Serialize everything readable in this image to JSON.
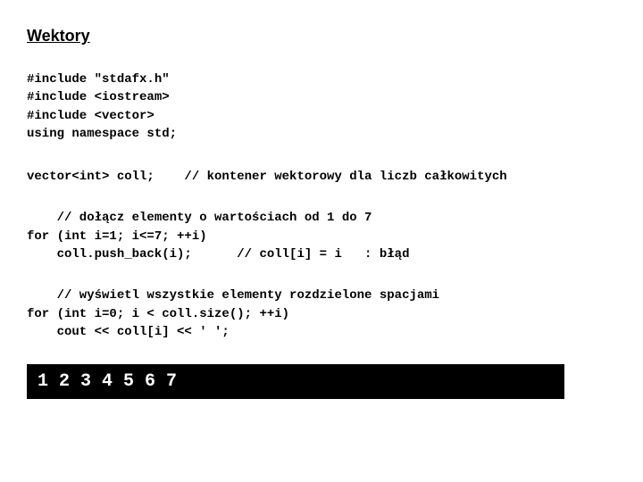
{
  "title": "Wektory",
  "includes": [
    "#include \"stdafx.h\"",
    "#include <iostream>",
    "#include <vector>",
    "using namespace std;"
  ],
  "decl": "vector<int> coll;    // kontener wektorowy dla liczb całkowitych",
  "loop1": {
    "comment": "    // dołącz elementy o wartościach od 1 do 7",
    "for": "for (int i=1; i<=7; ++i)",
    "body": "    coll.push_back(i);      // coll[i] = i   : błąd"
  },
  "loop2": {
    "comment": "    // wyświetl wszystkie elementy rozdzielone spacjami",
    "for": "for (int i=0; i < coll.size(); ++i)",
    "body": "    cout << coll[i] << ' ';"
  },
  "output": "1 2 3 4 5 6 7"
}
